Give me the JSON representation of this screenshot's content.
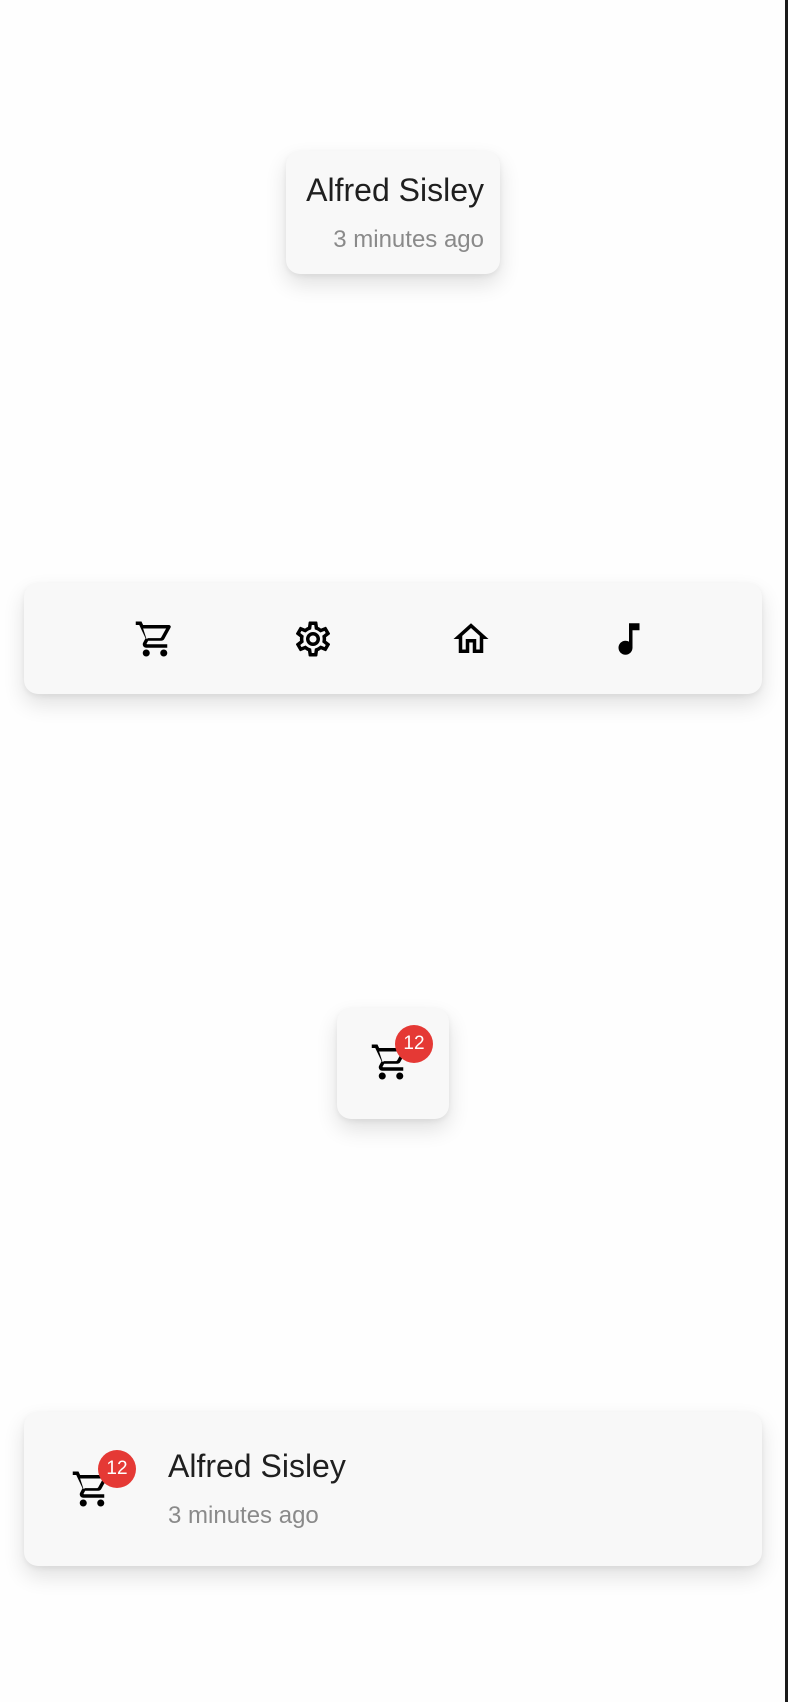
{
  "card_top": {
    "name": "Alfred Sisley",
    "time": "3 minutes ago"
  },
  "icon_bar": {
    "icons": [
      "cart-icon",
      "gear-icon",
      "home-icon",
      "music-note-icon"
    ]
  },
  "cart_card": {
    "badge_count": "12"
  },
  "list_card": {
    "badge_count": "12",
    "name": "Alfred Sisley",
    "time": "3 minutes ago"
  },
  "colors": {
    "badge": "#e53935",
    "card_bg": "#f8f8f8",
    "primary_text": "#1f1f1f",
    "secondary_text": "#8a8a8a"
  }
}
